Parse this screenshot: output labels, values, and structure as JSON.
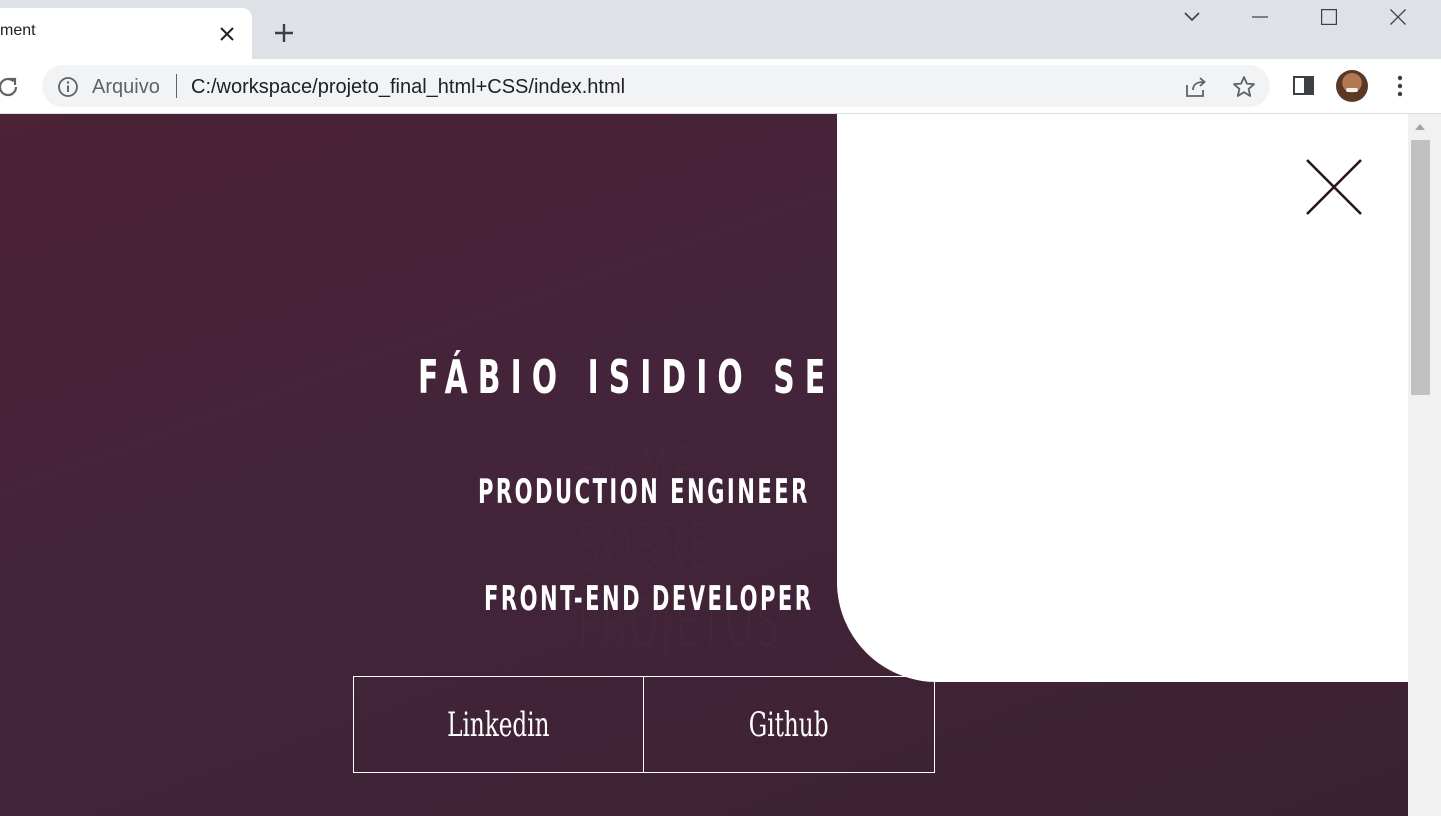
{
  "browser": {
    "tab_title": "ment",
    "omnibox": {
      "origin_label": "Arquivo",
      "url": "C:/workspace/projeto_final_html+CSS/index.html"
    }
  },
  "page": {
    "hero": {
      "name": "FÁBIO ISIDIO SEN",
      "role_1": "PRODUCTION ENGINEER",
      "role_2": "FRONT-END DEVELOPER"
    },
    "background_menu": {
      "items": [
        "HOME",
        "SOBRE",
        "PROJETOS"
      ]
    },
    "buttons": {
      "linkedin": "Linkedin",
      "github": "Github"
    },
    "colors": {
      "page_bg": "#43243a",
      "panel_bg": "#ffffff",
      "close_icon": "#2a1420",
      "text": "#ffffff"
    }
  }
}
